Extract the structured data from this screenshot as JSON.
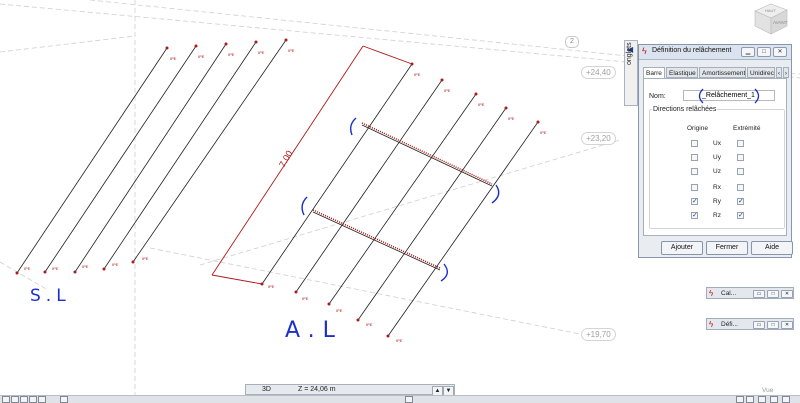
{
  "viewport": {
    "levels": [
      "+24,40",
      "+23,20",
      "+19,70"
    ],
    "story_badge": "2",
    "dimension_label": "7.00",
    "member_tag": "IPE",
    "view_cube": {
      "top_label": "HAUT",
      "front_label": "AVANT"
    },
    "annotations": {
      "left_group": "S.L",
      "right_group": "A.L"
    }
  },
  "side_panel": {
    "label": "onglets",
    "arrow": "◀"
  },
  "release_dialog": {
    "title": "Définition du relâchement",
    "tabs": [
      "Barre",
      "Elastique",
      "Amortissement",
      "Unidirecti"
    ],
    "name_label": "Nom:",
    "name_value": "_Relâchement_1",
    "group_title": "Directions relâchées",
    "col_origin": "Origine",
    "col_end": "Extrémité",
    "rows": [
      {
        "label": "Ux",
        "origin": false,
        "end": false
      },
      {
        "label": "Uy",
        "origin": false,
        "end": false
      },
      {
        "label": "Uz",
        "origin": false,
        "end": false
      },
      {
        "label": "Rx",
        "origin": false,
        "end": false
      },
      {
        "label": "Ry",
        "origin": true,
        "end": true
      },
      {
        "label": "Rz",
        "origin": true,
        "end": true
      }
    ],
    "buttons": {
      "add": "Ajouter",
      "close": "Fermer",
      "help": "Aide"
    }
  },
  "minimized_windows": [
    {
      "title": "Cal..."
    },
    {
      "title": "Défi..."
    }
  ],
  "status_bar": {
    "view_mode": "3D",
    "z_coordinate": "Z = 24,06 m",
    "view_label": "Vue"
  },
  "colors": {
    "beam": "#202020",
    "highlight": "#b01919",
    "annotation": "#1a2fd0",
    "grid": "#c9c9c9"
  }
}
